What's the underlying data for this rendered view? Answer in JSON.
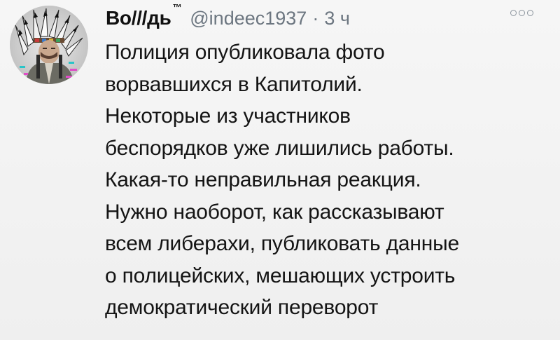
{
  "tweet": {
    "display_name": "Во///дь",
    "tm": "™",
    "handle": "@indeec1937",
    "separator": "·",
    "time": "3 ч",
    "text_lines": [
      "Полиция опубликовала фото",
      "ворвавшихся в Капитолий.",
      "Некоторые из участников",
      "беспорядков уже лишились работы.",
      "Какая-то неправильная реакция.",
      "Нужно наоборот, как рассказывают",
      "всем либерахи, публиковать данные",
      "о полицейских, мешающих устроить",
      "демократический переворот"
    ]
  },
  "icons": {
    "more": "more-options-icon",
    "avatar": "avatar-portrait-with-headdress"
  },
  "colors": {
    "background": "#f3f3f3",
    "text": "#141414",
    "secondary_text": "#6c7680"
  }
}
